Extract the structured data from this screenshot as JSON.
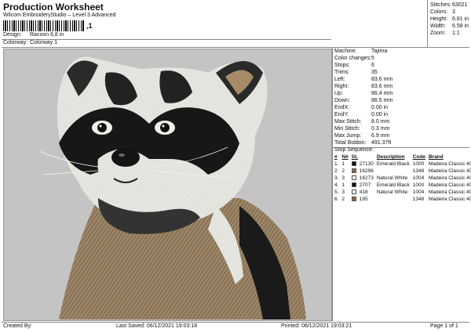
{
  "header": {
    "title": "Production Worksheet",
    "software": "Wilcom EmbroideryStudio – Level 3 Advanced",
    "barcode_text": ",1"
  },
  "meta": {
    "design_label": "Design:",
    "design_value": "Racoon 6,8 in",
    "colorway_label": "Colorway:",
    "colorway_value": "Colorway 1"
  },
  "stats": [
    {
      "label": "Stitches:",
      "value": "63021"
    },
    {
      "label": "Colors:",
      "value": "3"
    },
    {
      "label": "Height:",
      "value": "6.81 in"
    },
    {
      "label": "Width:",
      "value": "6.58 in"
    },
    {
      "label": "Zoom:",
      "value": "1:1"
    }
  ],
  "machine_info": [
    {
      "label": "Machine:",
      "value": "Tajima"
    },
    {
      "label": "Color changes:",
      "value": "5"
    },
    {
      "label": "Stops:",
      "value": "6"
    },
    {
      "label": "Trims:",
      "value": "35"
    },
    {
      "label": "Left:",
      "value": "83.6 mm"
    },
    {
      "label": "Right:",
      "value": "83.6 mm"
    },
    {
      "label": "Up:",
      "value": "86.4 mm"
    },
    {
      "label": "Down:",
      "value": "86.5 mm"
    },
    {
      "label": "EndX:",
      "value": "0.00 in"
    },
    {
      "label": "EndY:",
      "value": "0.00 in"
    },
    {
      "label": "Max Stitch:",
      "value": "8.0 mm"
    },
    {
      "label": "Min Stitch:",
      "value": "0.3 mm"
    },
    {
      "label": "Max Jump:",
      "value": "6.9 mm"
    },
    {
      "label": "Total Bobbin:",
      "value": "491.37ft"
    }
  ],
  "stop_sequence": {
    "title": "Stop Sequence:",
    "columns": [
      "#",
      "N#",
      "St.",
      "Description",
      "Code",
      "Brand"
    ],
    "rows": [
      {
        "num": "1.",
        "n": "1",
        "color": "#111111",
        "st": "27130",
        "desc": "Emerald Black",
        "code": "1000",
        "brand": "Madeira Classic 40"
      },
      {
        "num": "2.",
        "n": "2",
        "color": "#8a6a48",
        "st": "16296",
        "desc": "",
        "code": "1348",
        "brand": "Madeira Classic 40"
      },
      {
        "num": "3.",
        "n": "3",
        "color": "#f2f2f2",
        "st": "16273",
        "desc": "Natural White",
        "code": "1004",
        "brand": "Madeira Classic 40"
      },
      {
        "num": "4.",
        "n": "1",
        "color": "#111111",
        "st": "2707",
        "desc": "Emerald Black",
        "code": "1000",
        "brand": "Madeira Classic 40"
      },
      {
        "num": "5.",
        "n": "3",
        "color": "#f2f2f2",
        "st": "418",
        "desc": "Natural White",
        "code": "1004",
        "brand": "Madeira Classic 40"
      },
      {
        "num": "6.",
        "n": "2",
        "color": "#8a6a48",
        "st": "195",
        "desc": "",
        "code": "1348",
        "brand": "Madeira Classic 40"
      }
    ]
  },
  "footer": {
    "created_by": "Created By:",
    "last_saved": "Last Saved: 06/12/2021 19:03:18",
    "printed": "Printed: 06/12/2021 19:03:21",
    "page": "Page 1 of 1"
  }
}
